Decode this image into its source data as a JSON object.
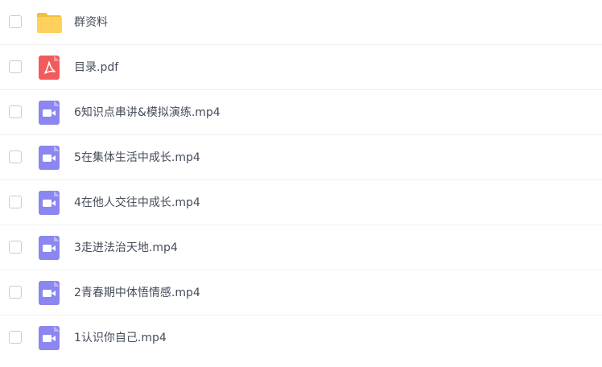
{
  "files": [
    {
      "name": "群资料",
      "icon": "folder-icon",
      "type": "folder"
    },
    {
      "name": "目录.pdf",
      "icon": "pdf-icon",
      "type": "pdf"
    },
    {
      "name": "6知识点串讲&模拟演练.mp4",
      "icon": "video-icon",
      "type": "video"
    },
    {
      "name": "5在集体生活中成长.mp4",
      "icon": "video-icon",
      "type": "video"
    },
    {
      "name": "4在他人交往中成长.mp4",
      "icon": "video-icon",
      "type": "video"
    },
    {
      "name": "3走进法治天地.mp4",
      "icon": "video-icon",
      "type": "video"
    },
    {
      "name": "2青春期中体悟情感.mp4",
      "icon": "video-icon",
      "type": "video"
    },
    {
      "name": "1认识你自己.mp4",
      "icon": "video-icon",
      "type": "video"
    }
  ],
  "colors": {
    "folder": "#ffd05c",
    "pdf": "#f15b5b",
    "video": "#8b86f0",
    "text": "#454d5a",
    "checkbox_border": "#c8cbd1"
  }
}
